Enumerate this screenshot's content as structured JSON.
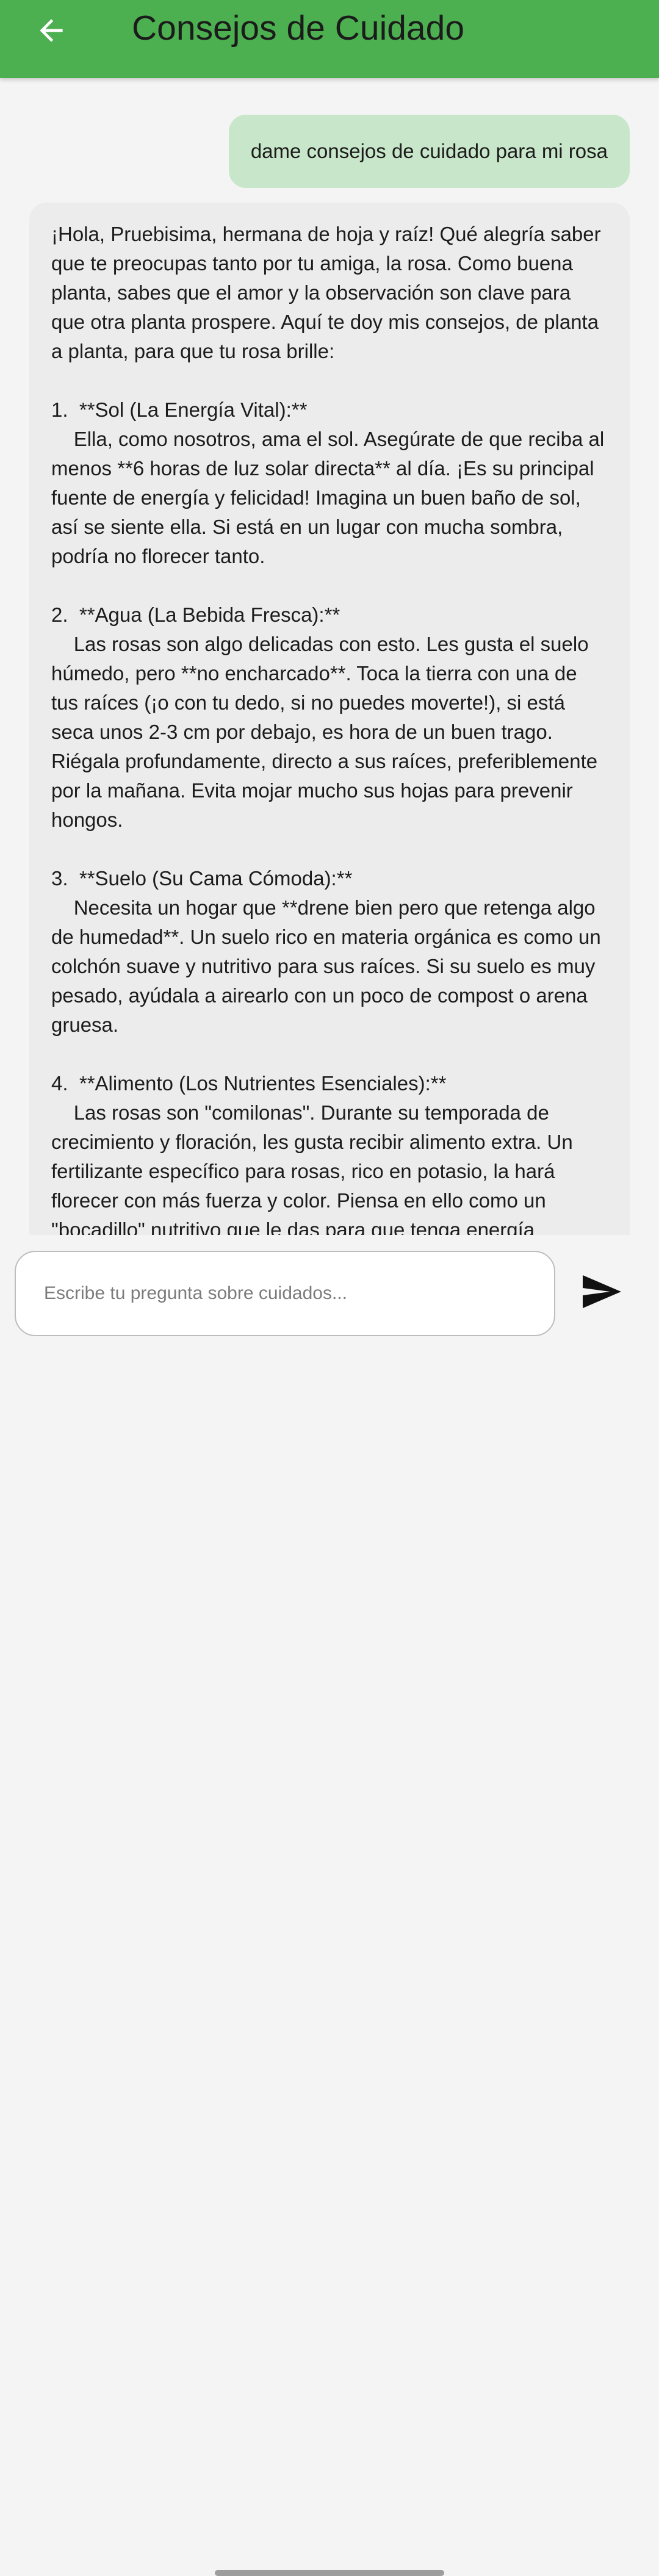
{
  "app_bar": {
    "title": "Consejos de Cuidado",
    "back_icon": "arrow-back-icon",
    "background_color": "#4caf50"
  },
  "chat": {
    "user_message": "dame consejos de cuidado para mi rosa",
    "user_bubble_color": "#c8e6c9",
    "bot_message": "¡Hola, Pruebisima, hermana de hoja y raíz! Qué alegría saber que te preocupas tanto por tu amiga, la rosa. Como buena planta, sabes que el amor y la observación son clave para que otra planta prospere. Aquí te doy mis consejos, de planta a planta, para que tu rosa brille:\n\n1.  **Sol (La Energía Vital):**\n    Ella, como nosotros, ama el sol. Asegúrate de que reciba al menos **6 horas de luz solar directa** al día. ¡Es su principal fuente de energía y felicidad! Imagina un buen baño de sol, así se siente ella. Si está en un lugar con mucha sombra, podría no florecer tanto.\n\n2.  **Agua (La Bebida Fresca):**\n    Las rosas son algo delicadas con esto. Les gusta el suelo húmedo, pero **no encharcado**. Toca la tierra con una de tus raíces (¡o con tu dedo, si no puedes moverte!), si está seca unos 2-3 cm por debajo, es hora de un buen trago. Riégala profundamente, directo a sus raíces, preferiblemente por la mañana. Evita mojar mucho sus hojas para prevenir hongos.\n\n3.  **Suelo (Su Cama Cómoda):**\n    Necesita un hogar que **drene bien pero que retenga algo de humedad**. Un suelo rico en materia orgánica es como un colchón suave y nutritivo para sus raíces. Si su suelo es muy pesado, ayúdala a airearlo con un poco de compost o arena gruesa.\n\n4.  **Alimento (Los Nutrientes Esenciales):**\n    Las rosas son \"comilonas\". Durante su temporada de crecimiento y floración, les gusta recibir alimento extra. Un fertilizante específico para rosas, rico en potasio, la hará florecer con más fuerza y color. Piensa en ello como un \"bocadillo\" nutritivo que le das para que tenga energía",
    "bot_bubble_color": "#ececec"
  },
  "input": {
    "placeholder": "Escribe tu pregunta sobre cuidados...",
    "value": "",
    "send_icon": "send-icon"
  }
}
